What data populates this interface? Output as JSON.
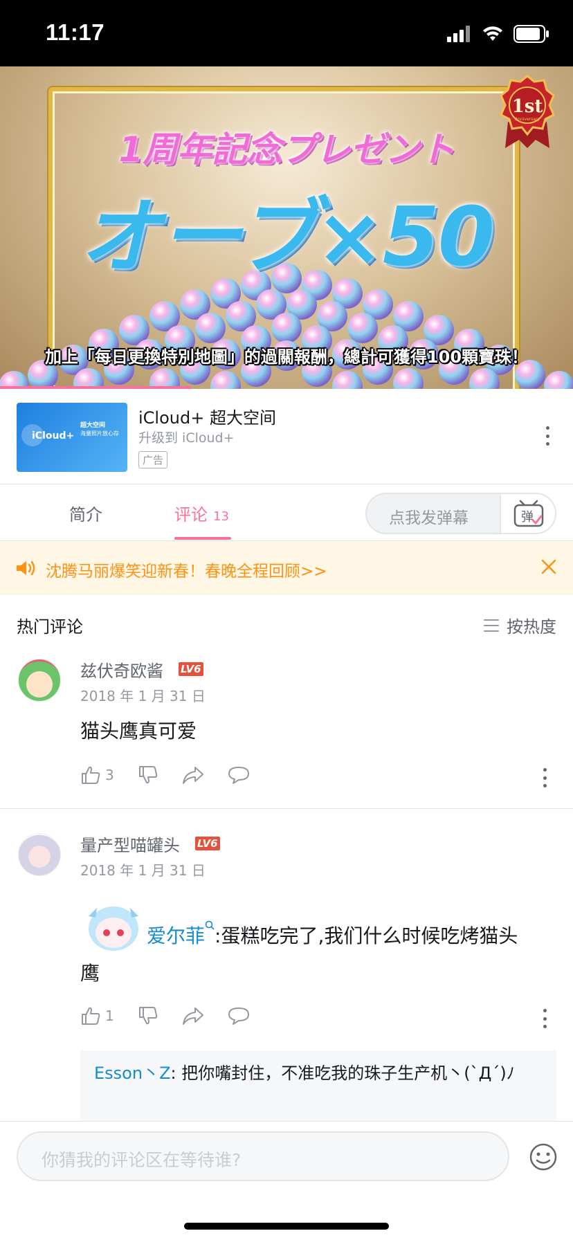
{
  "status_bar": {
    "time": "11:17"
  },
  "video": {
    "headline": "1周年記念プレゼント",
    "orb_text": "オーブ×50",
    "caption": "加上「每日更換特別地圖」的過關報酬，總計可獲得100顆寶珠！",
    "badge_text": "1st",
    "badge_sub": "Anniversary"
  },
  "ad": {
    "thumb_label": "iCloud+",
    "thumb_side_title": "超大空间",
    "thumb_side_sub": "海量照片放心存",
    "title": "iCloud+ 超大空间",
    "subtitle": "升级到 iCloud+",
    "tag": "广告"
  },
  "tabs": {
    "intro": "简介",
    "comments": "评论",
    "comments_count": "13",
    "danmaku_placeholder": "点我发弹幕",
    "danmaku_btn": "弹"
  },
  "notice": {
    "text": "沈腾马丽爆笑迎新春！春晚全程回顾>>"
  },
  "hot": {
    "title": "热门评论",
    "sort_label": "按热度"
  },
  "comments": [
    {
      "username": "兹伏奇欧酱",
      "level": "LV6",
      "date": "2018 年 1 月 31 日",
      "content": "猫头鹰真可爱",
      "likes": "3"
    },
    {
      "username": "量产型喵罐头",
      "level": "LV6",
      "date": "2018 年 1 月 31 日",
      "mention": "爱尔菲",
      "content_after_mention": ":蛋糕吃完了,我们什么时候吃烤猫头",
      "content_line2": "鹰",
      "likes": "1",
      "reply": {
        "name": "Esson丶Z",
        "text": ": 把你嘴封住，不准吃我的珠子生产机丶(`Д´)ﾉ"
      }
    }
  ],
  "bottom": {
    "placeholder": "你猜我的评论区在等待谁?"
  },
  "colors": {
    "accent": "#fb7299",
    "notice": "#ff9212",
    "mention": "#178bcf",
    "level": "#e6513c"
  }
}
